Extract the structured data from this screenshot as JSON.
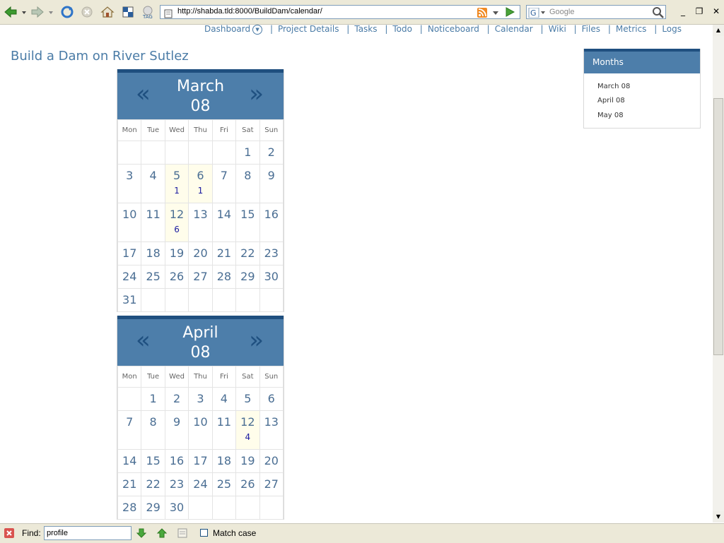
{
  "browser": {
    "url": "http://shabda.tld:8000/BuildDam/calendar/",
    "search_placeholder": "Google"
  },
  "nav": [
    {
      "label": "Dashboard"
    },
    {
      "label": "Project Details"
    },
    {
      "label": "Tasks"
    },
    {
      "label": "Todo"
    },
    {
      "label": "Noticeboard"
    },
    {
      "label": "Calendar"
    },
    {
      "label": "Wiki"
    },
    {
      "label": "Files"
    },
    {
      "label": "Metrics"
    },
    {
      "label": "Logs"
    }
  ],
  "page": {
    "title": "Build a Dam on River Sutlez"
  },
  "weekdays": [
    "Mon",
    "Tue",
    "Wed",
    "Thu",
    "Fri",
    "Sat",
    "Sun"
  ],
  "calendars": [
    {
      "month": "March",
      "year": "08",
      "prev": "«",
      "next": "»",
      "weeks": [
        [
          {
            "d": ""
          },
          {
            "d": ""
          },
          {
            "d": ""
          },
          {
            "d": ""
          },
          {
            "d": ""
          },
          {
            "d": "1"
          },
          {
            "d": "2"
          }
        ],
        [
          {
            "d": "3"
          },
          {
            "d": "4"
          },
          {
            "d": "5",
            "e": "1"
          },
          {
            "d": "6",
            "e": "1"
          },
          {
            "d": "7"
          },
          {
            "d": "8"
          },
          {
            "d": "9"
          }
        ],
        [
          {
            "d": "10"
          },
          {
            "d": "11"
          },
          {
            "d": "12",
            "e": "6"
          },
          {
            "d": "13"
          },
          {
            "d": "14"
          },
          {
            "d": "15"
          },
          {
            "d": "16"
          }
        ],
        [
          {
            "d": "17"
          },
          {
            "d": "18"
          },
          {
            "d": "19"
          },
          {
            "d": "20"
          },
          {
            "d": "21"
          },
          {
            "d": "22"
          },
          {
            "d": "23"
          }
        ],
        [
          {
            "d": "24"
          },
          {
            "d": "25"
          },
          {
            "d": "26"
          },
          {
            "d": "27"
          },
          {
            "d": "28"
          },
          {
            "d": "29"
          },
          {
            "d": "30"
          }
        ],
        [
          {
            "d": "31"
          },
          {
            "d": ""
          },
          {
            "d": ""
          },
          {
            "d": ""
          },
          {
            "d": ""
          },
          {
            "d": ""
          },
          {
            "d": ""
          }
        ]
      ]
    },
    {
      "month": "April",
      "year": "08",
      "prev": "«",
      "next": "»",
      "weeks": [
        [
          {
            "d": ""
          },
          {
            "d": "1"
          },
          {
            "d": "2"
          },
          {
            "d": "3"
          },
          {
            "d": "4"
          },
          {
            "d": "5"
          },
          {
            "d": "6"
          }
        ],
        [
          {
            "d": "7"
          },
          {
            "d": "8"
          },
          {
            "d": "9"
          },
          {
            "d": "10"
          },
          {
            "d": "11"
          },
          {
            "d": "12",
            "e": "4"
          },
          {
            "d": "13"
          }
        ],
        [
          {
            "d": "14"
          },
          {
            "d": "15"
          },
          {
            "d": "16"
          },
          {
            "d": "17"
          },
          {
            "d": "18"
          },
          {
            "d": "19"
          },
          {
            "d": "20"
          }
        ],
        [
          {
            "d": "21"
          },
          {
            "d": "22"
          },
          {
            "d": "23"
          },
          {
            "d": "24"
          },
          {
            "d": "25"
          },
          {
            "d": "26"
          },
          {
            "d": "27"
          }
        ],
        [
          {
            "d": "28"
          },
          {
            "d": "29"
          },
          {
            "d": "30"
          },
          {
            "d": ""
          },
          {
            "d": ""
          },
          {
            "d": ""
          },
          {
            "d": ""
          }
        ]
      ]
    }
  ],
  "sidebar": {
    "title": "Months",
    "items": [
      {
        "label": "March 08"
      },
      {
        "label": "April 08"
      },
      {
        "label": "May 08"
      }
    ]
  },
  "findbar": {
    "label": "Find:",
    "query": "profile",
    "match_case_label": "Match case",
    "match_case_checked": false
  },
  "colors": {
    "accent": "#4d7eaa",
    "accent_dark": "#1f4f7f",
    "link": "#4a7ba6",
    "event_bg": "#fffdeb"
  }
}
